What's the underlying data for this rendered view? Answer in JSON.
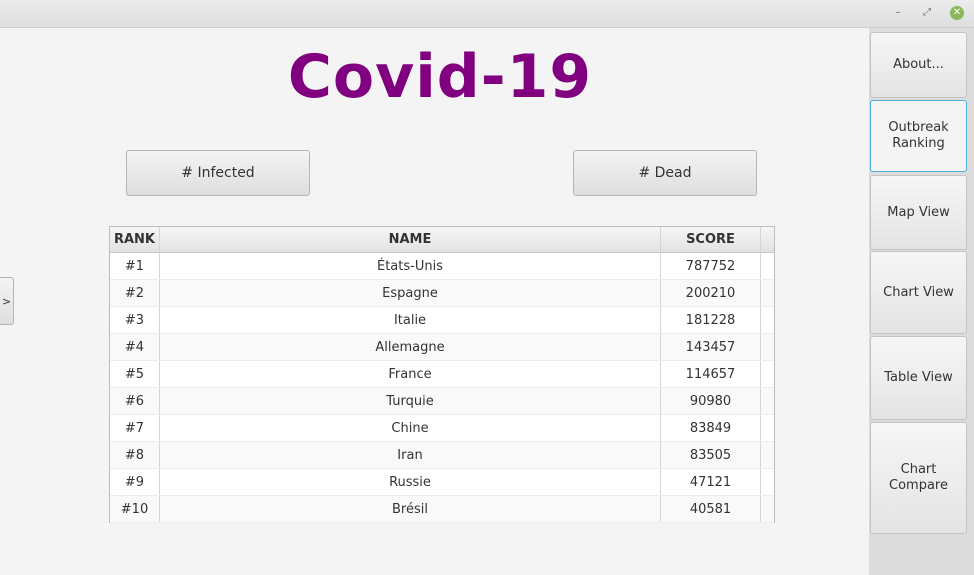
{
  "window": {
    "minimize_glyph": "–",
    "restore_glyph": "⤢",
    "close_glyph": "✕"
  },
  "title": "Covid-19",
  "buttons": {
    "infected": "# Infected",
    "dead": "# Dead"
  },
  "side_toggle": ">",
  "table": {
    "headers": {
      "rank": "RANK",
      "name": "NAME",
      "score": "SCORE"
    },
    "rows": [
      {
        "rank": "#1",
        "name": "États-Unis",
        "score": "787752"
      },
      {
        "rank": "#2",
        "name": "Espagne",
        "score": "200210"
      },
      {
        "rank": "#3",
        "name": "Italie",
        "score": "181228"
      },
      {
        "rank": "#4",
        "name": "Allemagne",
        "score": "143457"
      },
      {
        "rank": "#5",
        "name": "France",
        "score": "114657"
      },
      {
        "rank": "#6",
        "name": "Turquie",
        "score": "90980"
      },
      {
        "rank": "#7",
        "name": "Chine",
        "score": "83849"
      },
      {
        "rank": "#8",
        "name": "Iran",
        "score": "83505"
      },
      {
        "rank": "#9",
        "name": "Russie",
        "score": "47121"
      },
      {
        "rank": "#10",
        "name": "Brésil",
        "score": "40581"
      }
    ]
  },
  "sidebar": {
    "tabs": [
      {
        "label": "About...",
        "active": false
      },
      {
        "label": "Outbreak\nRanking",
        "active": true
      },
      {
        "label": "Map View",
        "active": false
      },
      {
        "label": "Chart View",
        "active": false
      },
      {
        "label": "Table View",
        "active": false
      },
      {
        "label": "Chart Compare",
        "active": false
      }
    ]
  },
  "colors": {
    "title": "#800080",
    "active_tab_border": "#4ab0d9",
    "close_button": "#8bb85a"
  }
}
